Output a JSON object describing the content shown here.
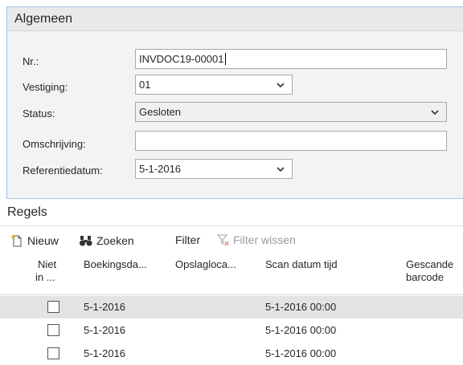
{
  "general": {
    "title": "Algemeen",
    "fields": {
      "nr": {
        "label": "Nr.:",
        "value": "INVDOC19-00001"
      },
      "location": {
        "label": "Vestiging:",
        "value": "01"
      },
      "status": {
        "label": "Status:",
        "value": "Gesloten"
      },
      "description": {
        "label": "Omschrijving:",
        "value": ""
      },
      "reference_date": {
        "label": "Referentiedatum:",
        "value": "5-1-2016"
      }
    }
  },
  "lines": {
    "title": "Regels",
    "actions": {
      "new": "Nieuw",
      "search": "Zoeken",
      "filter": "Filter",
      "clear_filter": "Filter wissen"
    },
    "columns": {
      "not_in_line1": "Niet",
      "not_in_line2": "in ...",
      "posting_date": "Boekingsda...",
      "storage_location": "Opslagloca...",
      "scan_datetime": "Scan datum tijd",
      "scanned_barcode_line1": "Gescande",
      "scanned_barcode_line2": "barcode"
    },
    "rows": [
      {
        "posting_date": "5-1-2016",
        "storage_location": "",
        "scan_datetime": "5-1-2016 00:00",
        "barcode": "",
        "selected": true
      },
      {
        "posting_date": "5-1-2016",
        "storage_location": "",
        "scan_datetime": "5-1-2016 00:00",
        "barcode": "",
        "selected": false
      },
      {
        "posting_date": "5-1-2016",
        "storage_location": "",
        "scan_datetime": "5-1-2016 00:00",
        "barcode": "",
        "selected": false
      }
    ]
  },
  "icons": {
    "new": "new-document-icon",
    "search": "binoculars-icon",
    "clear_filter": "clear-filter-icon",
    "dropdown": "chevron-down-icon"
  },
  "colors": {
    "accent_border": "#9fc3e7",
    "selected_row": "#e3e3e3",
    "new_icon_star": "#f2b200"
  }
}
